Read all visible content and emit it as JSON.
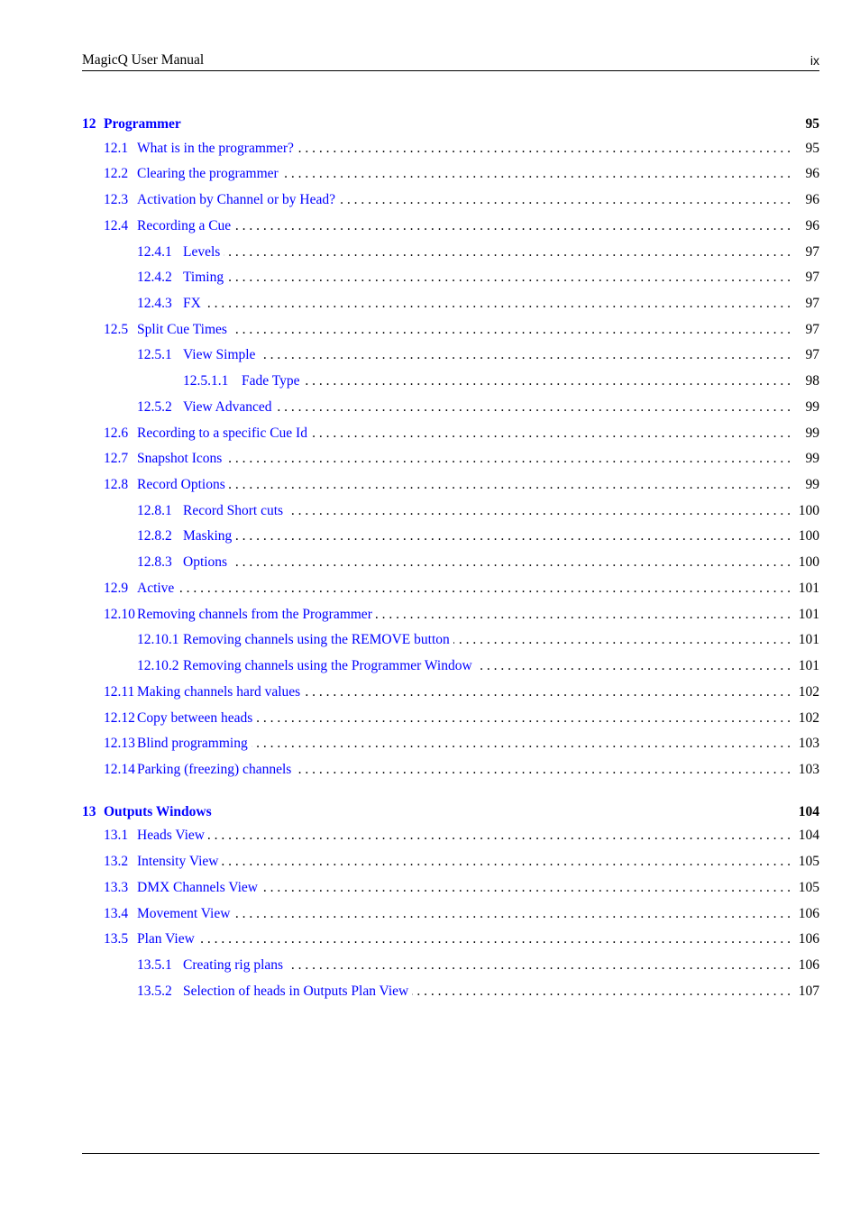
{
  "header": {
    "title": "MagicQ User Manual",
    "page_number": "ix"
  },
  "toc": [
    {
      "number": "12",
      "title": "Programmer",
      "page": "95",
      "entries": [
        {
          "level": 1,
          "number": "12.1",
          "title": "What is in the programmer?",
          "page": "95"
        },
        {
          "level": 1,
          "number": "12.2",
          "title": "Clearing the programmer",
          "page": "96"
        },
        {
          "level": 1,
          "number": "12.3",
          "title": "Activation by Channel or by Head?",
          "page": "96"
        },
        {
          "level": 1,
          "number": "12.4",
          "title": "Recording a Cue",
          "page": "96"
        },
        {
          "level": 2,
          "number": "12.4.1",
          "title": "Levels",
          "page": "97"
        },
        {
          "level": 2,
          "number": "12.4.2",
          "title": "Timing",
          "page": "97"
        },
        {
          "level": 2,
          "number": "12.4.3",
          "title": "FX",
          "page": "97"
        },
        {
          "level": 1,
          "number": "12.5",
          "title": "Split Cue Times",
          "page": "97"
        },
        {
          "level": 2,
          "number": "12.5.1",
          "title": "View Simple",
          "page": "97"
        },
        {
          "level": 3,
          "number": "12.5.1.1",
          "title": "Fade Type",
          "page": "98"
        },
        {
          "level": 2,
          "number": "12.5.2",
          "title": "View Advanced",
          "page": "99"
        },
        {
          "level": 1,
          "number": "12.6",
          "title": "Recording to a specific Cue Id",
          "page": "99"
        },
        {
          "level": 1,
          "number": "12.7",
          "title": "Snapshot Icons",
          "page": "99"
        },
        {
          "level": 1,
          "number": "12.8",
          "title": "Record Options",
          "page": "99"
        },
        {
          "level": 2,
          "number": "12.8.1",
          "title": "Record Short cuts",
          "page": "100"
        },
        {
          "level": 2,
          "number": "12.8.2",
          "title": "Masking",
          "page": "100"
        },
        {
          "level": 2,
          "number": "12.8.3",
          "title": "Options",
          "page": "100"
        },
        {
          "level": 1,
          "number": "12.9",
          "title": "Active",
          "page": "101"
        },
        {
          "level": 1,
          "number": "12.10",
          "title": "Removing channels from the Programmer",
          "page": "101"
        },
        {
          "level": 2,
          "number": "12.10.1",
          "title": "Removing channels using the REMOVE button",
          "page": "101"
        },
        {
          "level": 2,
          "number": "12.10.2",
          "title": "Removing channels using the Programmer Window",
          "page": "101"
        },
        {
          "level": 1,
          "number": "12.11",
          "title": "Making channels hard values",
          "page": "102"
        },
        {
          "level": 1,
          "number": "12.12",
          "title": "Copy between heads",
          "page": "102"
        },
        {
          "level": 1,
          "number": "12.13",
          "title": "Blind programming",
          "page": "103"
        },
        {
          "level": 1,
          "number": "12.14",
          "title": "Parking (freezing) channels",
          "page": "103"
        }
      ]
    },
    {
      "number": "13",
      "title": "Outputs Windows",
      "page": "104",
      "entries": [
        {
          "level": 1,
          "number": "13.1",
          "title": "Heads View",
          "page": "104"
        },
        {
          "level": 1,
          "number": "13.2",
          "title": "Intensity View",
          "page": "105"
        },
        {
          "level": 1,
          "number": "13.3",
          "title": "DMX Channels View",
          "page": "105"
        },
        {
          "level": 1,
          "number": "13.4",
          "title": "Movement View",
          "page": "106"
        },
        {
          "level": 1,
          "number": "13.5",
          "title": "Plan View",
          "page": "106"
        },
        {
          "level": 2,
          "number": "13.5.1",
          "title": "Creating rig plans",
          "page": "106"
        },
        {
          "level": 2,
          "number": "13.5.2",
          "title": "Selection of heads in Outputs Plan View",
          "page": "107"
        }
      ]
    }
  ],
  "colors": {
    "link": "#0000ff",
    "text": "#000000"
  }
}
